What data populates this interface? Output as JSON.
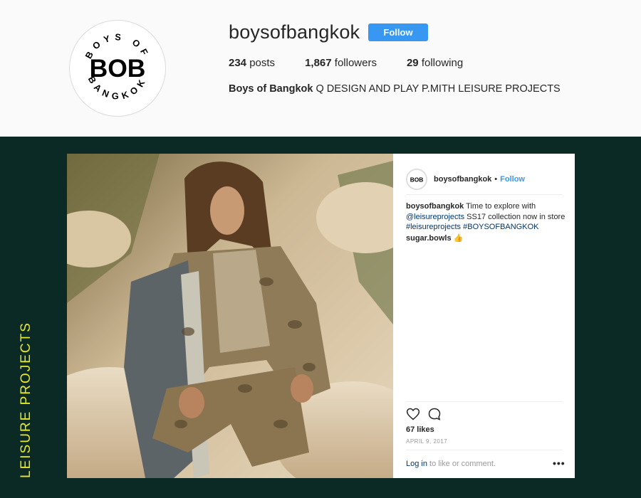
{
  "profile": {
    "avatar_label": "BOB",
    "avatar_ring_top": "BOYS OF",
    "avatar_ring_bottom": "BANGKOK",
    "username": "boysofbangkok",
    "follow_label": "Follow",
    "stats": {
      "posts_count": "234",
      "posts_label": "posts",
      "followers_count": "1,867",
      "followers_label": "followers",
      "following_count": "29",
      "following_label": "following"
    },
    "bio_name": "Boys of Bangkok",
    "bio_text": " Q DESIGN AND PLAY P.MITH LEISURE PROJECTS"
  },
  "side_label": "LEISURE PROJECTS",
  "post": {
    "username": "boysofbangkok",
    "separator": "•",
    "follow_label": "Follow",
    "caption_user": "boysofbangkok",
    "caption_text_1": " Time to explore with ",
    "caption_mention": "@leisureprojects",
    "caption_text_2": " SS17 collection now in store ",
    "caption_tag_1": "#leisureprojects",
    "caption_tag_2": "#BOYSOFBANGKOK",
    "comment_user": "sugar.bowls",
    "comment_emoji": "👍",
    "likes": "67 likes",
    "date": "APRIL 9, 2017",
    "login_link": "Log in",
    "login_text": " to like or comment.",
    "more_label": "•••"
  },
  "colors": {
    "accent": "#3897f0",
    "dark_bg": "#0c2a25",
    "side_label": "#e6e62a",
    "link": "#003569"
  }
}
